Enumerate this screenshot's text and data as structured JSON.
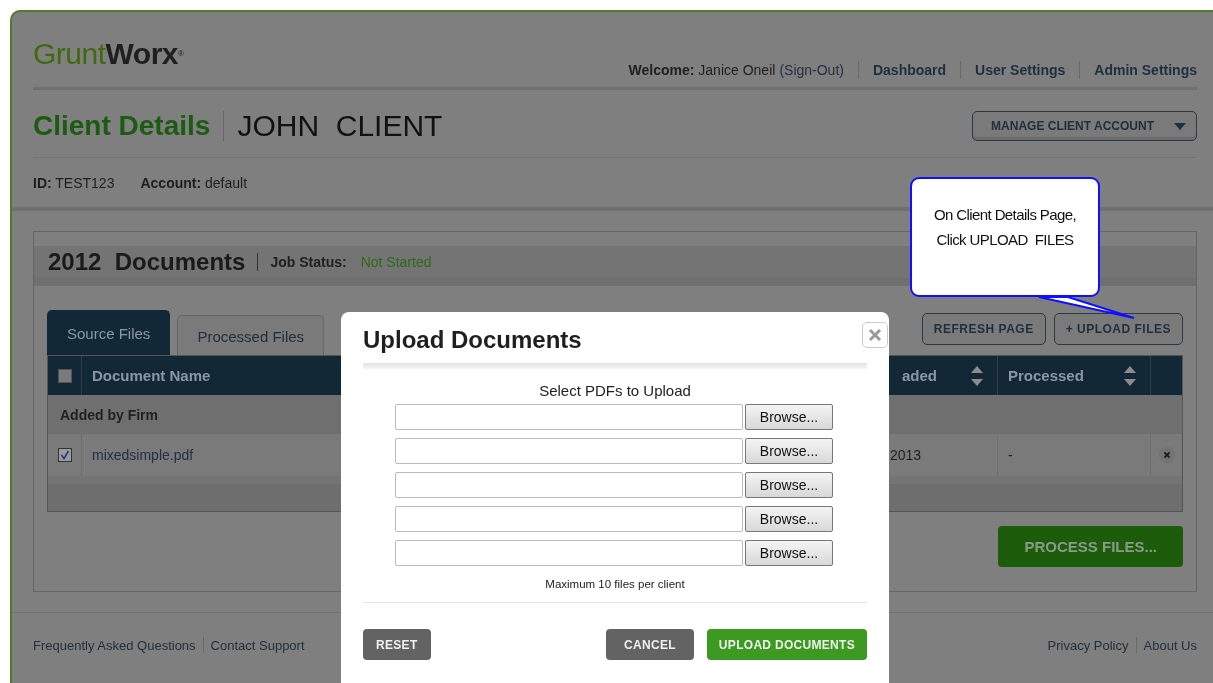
{
  "logo": {
    "light": "Grunt",
    "bold": "Worx",
    "mark": "®"
  },
  "nav": {
    "welcome_label": "Welcome:",
    "user": "Janice Oneil",
    "sign_out": "(Sign-Out)",
    "links": [
      "Dashboard",
      "User Settings",
      "Admin Settings"
    ]
  },
  "page_title": "Client Details",
  "client_name": "JOHN  CLIENT",
  "manage_button": "MANAGE CLIENT ACCOUNT",
  "info": [
    {
      "label": "ID:",
      "value": "TEST123"
    },
    {
      "label": "Account:",
      "value": "default"
    }
  ],
  "documents": {
    "title": "2012  Documents",
    "job_status_label": "Job Status:",
    "job_status": "Not Started",
    "tabs": [
      {
        "label": "Source Files",
        "selected": true
      },
      {
        "label": "Processed Files",
        "selected": false
      }
    ],
    "buttons": [
      "REFRESH PAGE",
      "+ UPLOAD FILES"
    ],
    "table": {
      "select_all_checked": false,
      "columns": [
        {
          "label": "Document Name"
        },
        {
          "label": "aded",
          "sortable": true
        },
        {
          "label": "Processed",
          "sortable": true
        }
      ],
      "groups": [
        {
          "label": "Added by Firm",
          "rows": [
            {
              "checked": true,
              "name": "mixedsimple.pdf",
              "uploaded": "2013",
              "processed": "-"
            }
          ]
        }
      ]
    },
    "process_button": "PROCESS FILES..."
  },
  "footer": {
    "left": [
      "Frequently Asked Questions",
      "Contact Support"
    ],
    "right": [
      "Privacy Policy",
      "About Us"
    ]
  },
  "callout": {
    "lines": [
      "On Client Details Page,",
      "Click UPLOAD  FILES"
    ]
  },
  "dialog": {
    "title": "Upload Documents",
    "instruction": "Select PDFs to Upload",
    "file_inputs": [
      {
        "button": "Browse..."
      },
      {
        "button": "Browse..."
      },
      {
        "button": "Browse..."
      },
      {
        "button": "Browse..."
      },
      {
        "button": "Browse..."
      }
    ],
    "note": "Maximum 10 files per client",
    "buttons": [
      {
        "label": "RESET",
        "kind": "secondary"
      },
      {
        "label": "CANCEL",
        "kind": "secondary"
      },
      {
        "label": "UPLOAD DOCUMENTS",
        "kind": "primary"
      }
    ]
  }
}
